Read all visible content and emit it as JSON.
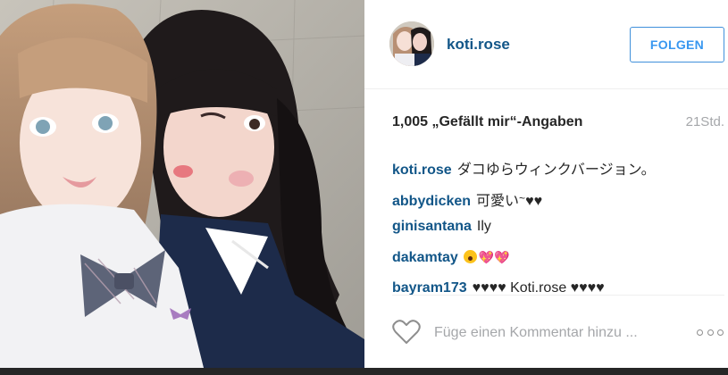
{
  "post": {
    "username": "koti.rose",
    "follow_label": "FOLGEN",
    "likes": "1,005 „Gefällt mir“-Angaben",
    "time": "21Std."
  },
  "comments": [
    {
      "user": "koti.rose",
      "text": "ダコゆらウィンクバージョン。"
    },
    {
      "user": "abbydicken",
      "text": "可愛い",
      "tilde": "~",
      "hearts": "♥♥"
    },
    {
      "user": "ginisantana",
      "text": "Ily"
    },
    {
      "user": "dakamtay",
      "emoji": "face-with-open-mouth, sparkling-heart x2",
      "emoji_hearts": "💖💖"
    },
    {
      "user": "bayram173",
      "text": "♥♥♥♥ Koti.rose ♥♥♥♥"
    }
  ],
  "footer": {
    "comment_placeholder": "Füge einen Kommentar hinzu ...",
    "like_icon": "heart-outline-icon",
    "more_icon": "three-dots-icon"
  },
  "colors": {
    "username_blue": "#125688",
    "follow_blue": "#3897f0",
    "text_dark": "#262626",
    "text_gray": "#a5a7aa"
  }
}
